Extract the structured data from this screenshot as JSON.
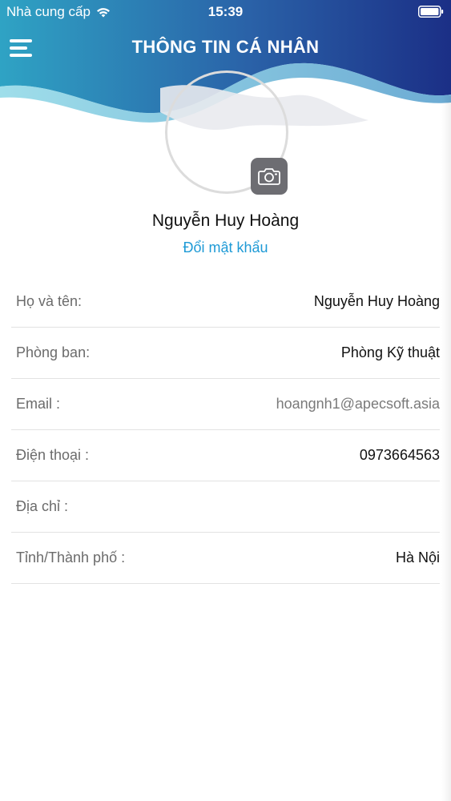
{
  "status_bar": {
    "carrier": "Nhà cung cấp",
    "time": "15:39",
    "wifi_icon": "wifi-icon",
    "battery_icon": "battery-icon"
  },
  "header": {
    "title": "THÔNG TIN CÁ NHÂN",
    "menu_icon": "hamburger-menu-icon"
  },
  "profile": {
    "name": "Nguyễn Huy Hoàng",
    "change_password": "Đổi mật khẩu",
    "camera_icon": "camera-icon"
  },
  "info": [
    {
      "label": "Họ và tên:",
      "value": "Nguyễn Huy Hoàng"
    },
    {
      "label": "Phòng ban:",
      "value": "Phòng Kỹ thuật"
    },
    {
      "label": "Email :",
      "value": "hoangnh1@apecsoft.asia"
    },
    {
      "label": "Điện thoại :",
      "value": "0973664563"
    },
    {
      "label": "Địa chỉ :",
      "value": ""
    },
    {
      "label": "Tỉnh/Thành phố :",
      "value": "Hà Nội"
    }
  ],
  "colors": {
    "header_gradient_start": "#2fa3c4",
    "header_gradient_end": "#1b2f86",
    "link": "#1e9ad6",
    "camera_button": "#6d6d72"
  }
}
